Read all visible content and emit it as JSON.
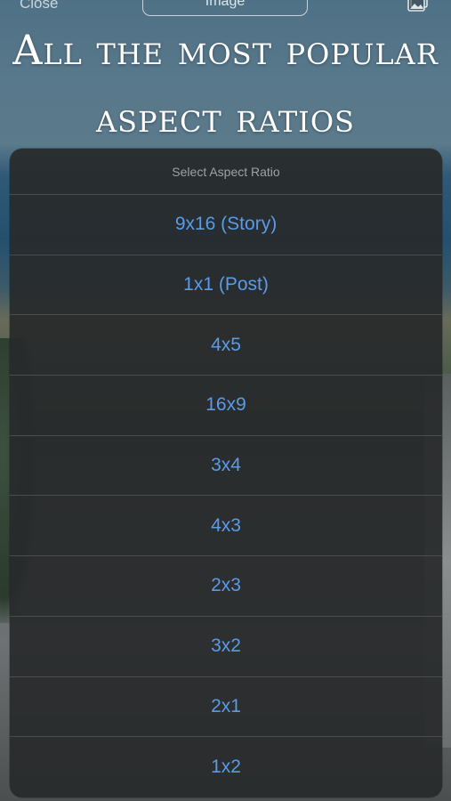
{
  "nav": {
    "close_label": "Close",
    "segment_label": "Image",
    "icon": "photo-library-icon"
  },
  "headline": {
    "line1": "All the most popular",
    "line2": "aspect ratios"
  },
  "sheet": {
    "title": "Select Aspect Ratio",
    "options": [
      "9x16 (Story)",
      "1x1 (Post)",
      "4x5",
      "16x9",
      "3x4",
      "4x3",
      "2x3",
      "3x2",
      "2x1",
      "1x2"
    ]
  },
  "colors": {
    "option_text": "#5a9be8",
    "sheet_background": "#282a2b",
    "title_text": "#9ea2a6",
    "separator": "#4a4d4f"
  }
}
